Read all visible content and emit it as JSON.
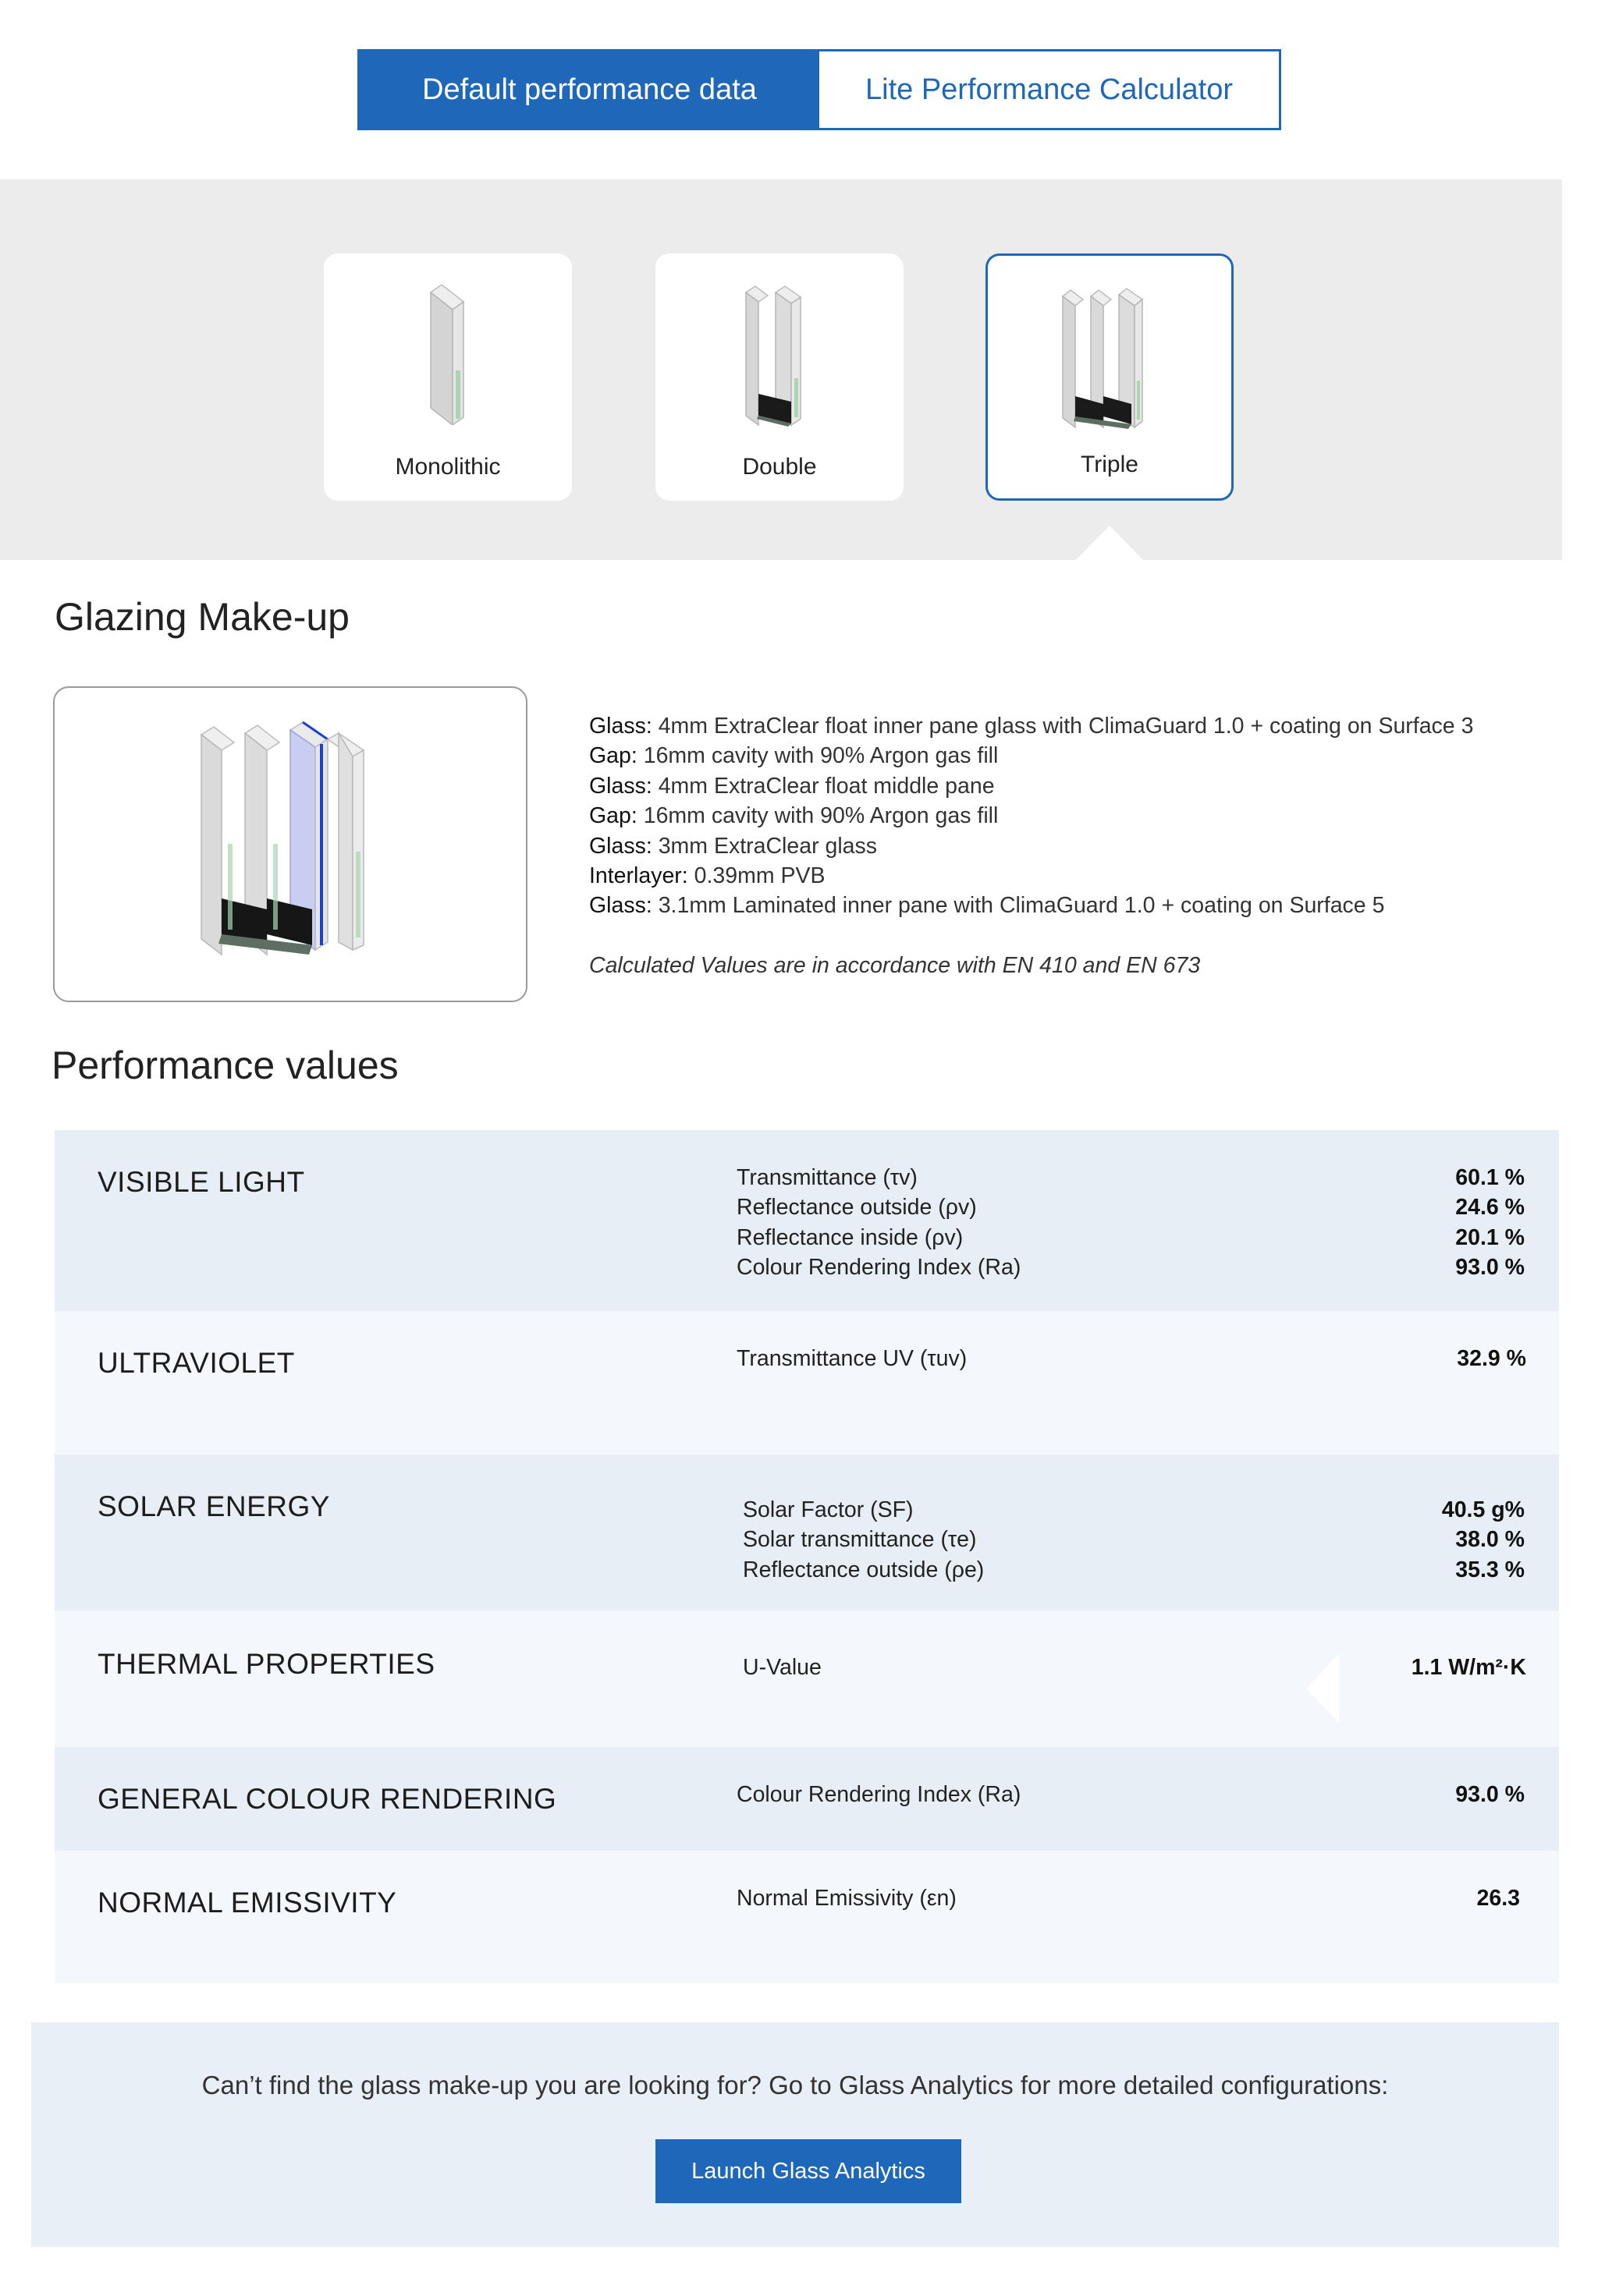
{
  "toggle": {
    "default_label": "Default performance data",
    "calculator_label": "Lite Performance Calculator"
  },
  "types": [
    {
      "label": "Monolithic"
    },
    {
      "label": "Double"
    },
    {
      "label": "Triple"
    }
  ],
  "makeup": {
    "heading": "Glazing Make-up",
    "rows": [
      {
        "key": "Glass:",
        "value": " 4mm ExtraClear float inner pane glass with ClimaGuard 1.0 + coating on Surface 3"
      },
      {
        "key": "Gap:",
        "value": " 16mm cavity with 90% Argon gas fill"
      },
      {
        "key": "Glass:",
        "value": " 4mm ExtraClear float middle pane"
      },
      {
        "key": "Gap:",
        "value": " 16mm cavity with 90% Argon gas fill"
      },
      {
        "key": "Glass:",
        "value": " 3mm ExtraClear glass"
      },
      {
        "key": "Interlayer:",
        "value": " 0.39mm PVB"
      },
      {
        "key": "Glass:",
        "value": " 3.1mm Laminated inner pane with ClimaGuard 1.0 + coating on Surface 5"
      }
    ],
    "note": "Calculated Values are in accordance with EN 410 and EN 673"
  },
  "performance": {
    "heading": "Performance values",
    "sections": [
      {
        "title": "VISIBLE LIGHT",
        "props": [
          "Transmittance (τv)",
          "Reflectance outside (ρv)",
          "Reflectance inside (ρv)",
          "Colour Rendering Index (Ra)"
        ],
        "values": [
          "60.1 %",
          "24.6 %",
          "20.1 %",
          "93.0 %"
        ]
      },
      {
        "title": "ULTRAVIOLET",
        "props": [
          "Transmittance UV (τuv)"
        ],
        "values": [
          "32.9 %"
        ]
      },
      {
        "title": "SOLAR ENERGY",
        "props": [
          "Solar Factor (SF)",
          "Solar transmittance (τe)",
          "Reflectance outside (ρe)"
        ],
        "values": [
          "40.5 g%",
          "38.0 %",
          "35.3 %"
        ]
      },
      {
        "title": "THERMAL PROPERTIES",
        "props": [
          "U-Value"
        ],
        "values": [
          "1.1 W/m²·K"
        ]
      },
      {
        "title": "GENERAL COLOUR RENDERING",
        "props": [
          "Colour Rendering Index (Ra)"
        ],
        "values": [
          "93.0 %"
        ]
      },
      {
        "title": "NORMAL EMISSIVITY",
        "props": [
          "Normal Emissivity (εn)"
        ],
        "values": [
          "26.3"
        ]
      }
    ]
  },
  "footer": {
    "message": "Can’t find the glass make-up you are looking for? Go to Glass Analytics for more detailed configurations:",
    "button_label": "Launch Glass Analytics"
  },
  "colors": {
    "primary": "#1f67b9",
    "band_bg": "#ececec",
    "section_dark": "#e8eef6",
    "section_light": "#f4f7fb"
  }
}
